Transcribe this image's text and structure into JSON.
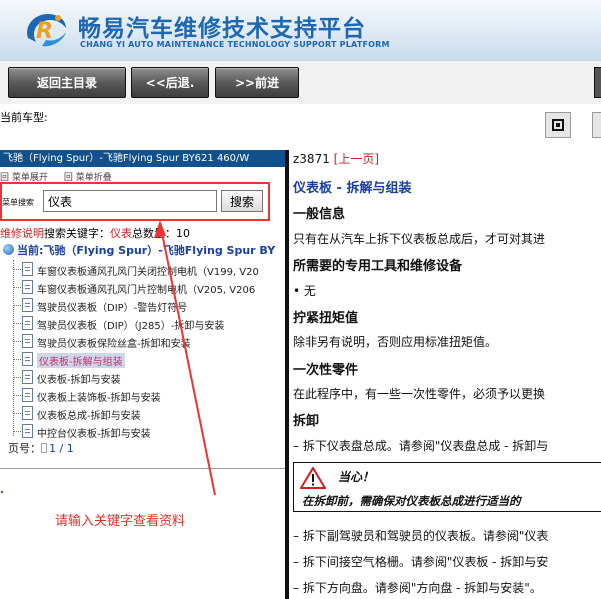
{
  "header": {
    "title": "畅易汽车维修技术支持平台",
    "subtitle": "CHANG YI AUTO MAINTENANCE TECHNOLOGY SUPPORT PLATFORM",
    "brand_color": "#1d67b3"
  },
  "nav": {
    "home_label": "返回主目录",
    "back_label": "<<后退.",
    "forward_label": ">>前进"
  },
  "current_model_label": "当前车型:",
  "left": {
    "model_bar": "飞驰（Flying Spur）-飞驰Flying Spur BY621 460/W",
    "menu_expand": "菜单展开",
    "menu_collapse": "菜单折叠",
    "search_label": "菜单搜索",
    "search_value": "仪表",
    "search_button": "搜索",
    "result_prefix": "维修说明",
    "result_mid": "搜索关键字：",
    "result_keyword": "仪表",
    "result_count_label": "总数量：",
    "result_count": "10",
    "current_prefix": "当前:",
    "current_path": "飞驰（Flying Spur）-飞驰Flying Spur BY",
    "tree_items": [
      {
        "label": "车窗仪表板通风孔风门关闭控制电机（V199, V20"
      },
      {
        "label": "车窗仪表板通风孔风门片控制电机（V205, V206"
      },
      {
        "label": "驾驶员仪表板（DIP）-警告灯符号"
      },
      {
        "label": "驾驶员仪表板（DIP）（J285）-拆卸与安装"
      },
      {
        "label": "驾驶员仪表板保险丝盒-拆卸和安装"
      },
      {
        "label": "仪表板-拆解与组装"
      },
      {
        "label": "仪表板-拆卸与安装"
      },
      {
        "label": "仪表板上装饰板-拆卸与安装"
      },
      {
        "label": "仪表板总成-拆卸与安装"
      },
      {
        "label": "中控台仪表板-拆卸与安装"
      }
    ],
    "active_index": 5,
    "pager_label": "页号：",
    "pager_value": "1 / 1",
    "annotation": "请输入关键字查看资料",
    "annotation_color": "#e0302a"
  },
  "right": {
    "doc_code": "z3871",
    "prev_page": "[上一页]",
    "title": "仪表板 - 拆解与组装",
    "general_info_h": "一般信息",
    "general_info_p": "只有在从汽车上拆下仪表板总成后，才可对其进",
    "tools_h": "所需要的专用工具和维修设备",
    "tools_item": "• 无",
    "torque_h": "拧紧扭矩值",
    "torque_p": "除非另有说明，否则应用标准扭矩值。",
    "onetime_h": "一次性零件",
    "onetime_p": "在此程序中，有一些一次性零件，必须予以更换",
    "removal_h": "拆卸",
    "step1": "– 拆下仪表盘总成。请参阅\"仪表盘总成 - 拆卸与",
    "caution_title": "当心！",
    "caution_text": "在拆卸前，需确保对仪表板总成进行适当的",
    "step2": "– 拆下副驾驶员和驾驶员的仪表板。请参阅\"仪表",
    "step3": "– 拆下间接空气格栅。请参阅\"仪表板 - 拆卸与安",
    "step4": "– 拆下方向盘。请参阅\"方向盘 - 拆卸与安装\"。"
  }
}
